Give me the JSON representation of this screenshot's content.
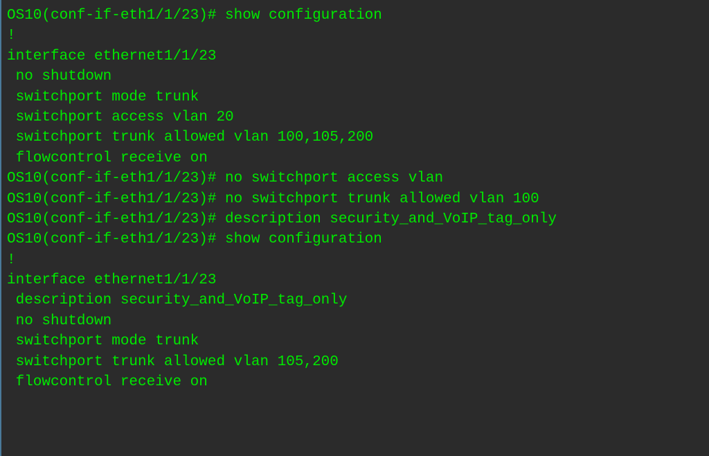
{
  "terminal": {
    "lines": [
      "OS10(conf-if-eth1/1/23)# show configuration",
      "!",
      "interface ethernet1/1/23",
      " no shutdown",
      " switchport mode trunk",
      " switchport access vlan 20",
      " switchport trunk allowed vlan 100,105,200",
      " flowcontrol receive on",
      "OS10(conf-if-eth1/1/23)# no switchport access vlan",
      "OS10(conf-if-eth1/1/23)# no switchport trunk allowed vlan 100",
      "OS10(conf-if-eth1/1/23)# description security_and_VoIP_tag_only",
      "OS10(conf-if-eth1/1/23)# show configuration",
      "!",
      "interface ethernet1/1/23",
      " description security_and_VoIP_tag_only",
      " no shutdown",
      " switchport mode trunk",
      " switchport trunk allowed vlan 105,200",
      " flowcontrol receive on"
    ]
  }
}
